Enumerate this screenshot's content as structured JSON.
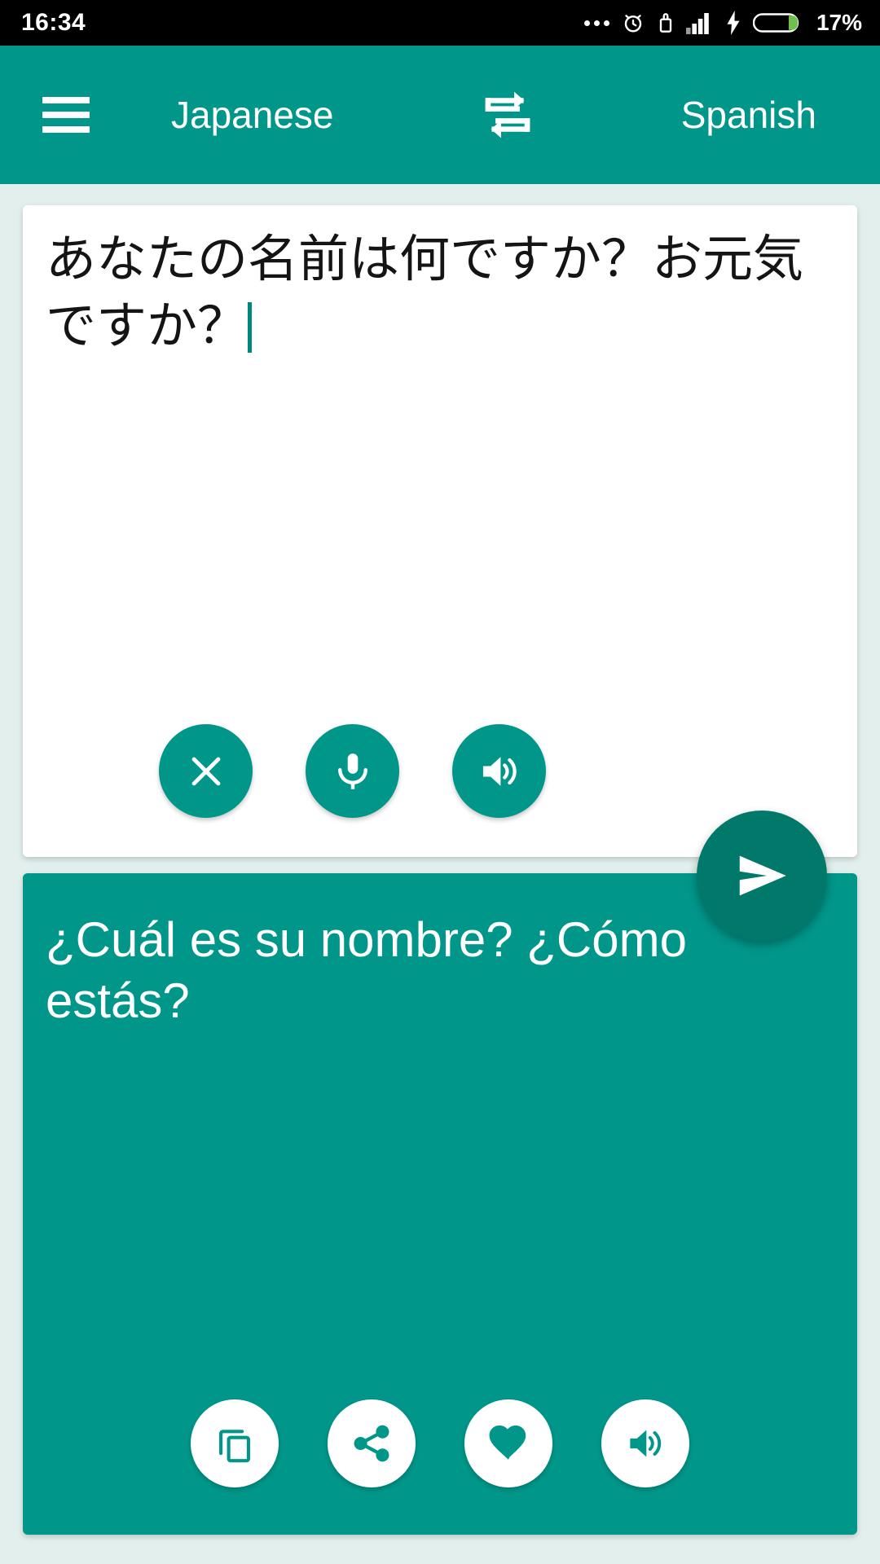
{
  "status_bar": {
    "time": "16:34",
    "battery_percent": "17%",
    "icons": [
      "more-dots-icon",
      "alarm-clock-icon",
      "usb-icon",
      "signal-bars-icon",
      "charging-bolt-icon",
      "battery-icon"
    ]
  },
  "header": {
    "menu_icon": "hamburger-menu-icon",
    "source_language": "Japanese",
    "swap_icon": "swap-languages-icon",
    "target_language": "Spanish"
  },
  "source_panel": {
    "text": "あなたの名前は何ですか？お元気ですか？",
    "has_caret": true,
    "actions": [
      {
        "name": "clear-button",
        "icon": "close-icon"
      },
      {
        "name": "voice-input-button",
        "icon": "microphone-icon"
      },
      {
        "name": "speak-source-button",
        "icon": "speaker-icon"
      }
    ]
  },
  "send_button": {
    "name": "translate-send-button",
    "icon": "send-icon"
  },
  "target_panel": {
    "text": "¿Cuál es su nombre? ¿Cómo estás?",
    "actions": [
      {
        "name": "copy-button",
        "icon": "copy-icon"
      },
      {
        "name": "share-button",
        "icon": "share-icon"
      },
      {
        "name": "favorite-button",
        "icon": "heart-icon"
      },
      {
        "name": "speak-translation-button",
        "icon": "speaker-icon"
      }
    ]
  },
  "colors": {
    "primary": "#00968a",
    "primary_dark": "#00796b",
    "background": "#e2efec",
    "status_bar": "#000000",
    "battery_fill": "#6cc24a"
  }
}
